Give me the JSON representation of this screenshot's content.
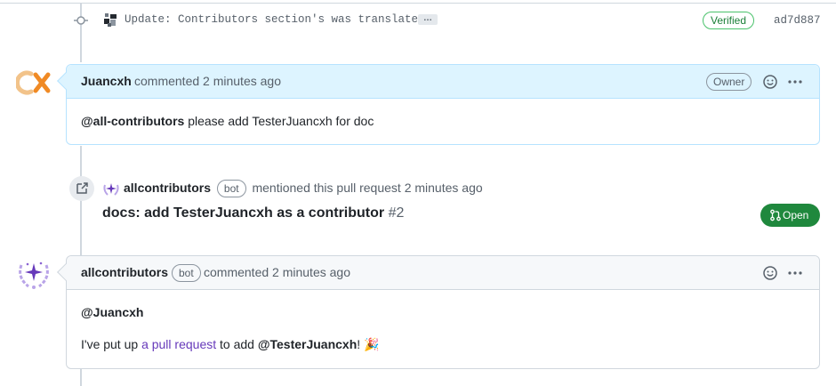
{
  "commit": {
    "message": "Update: Contributors section's was translate",
    "ellipsis": "…",
    "verified_label": "Verified",
    "sha": "ad7d887"
  },
  "owner_comment": {
    "author": "Juancxh",
    "meta": "commented 2 minutes ago",
    "role_badge": "Owner",
    "body_mention": "@all-contributors",
    "body_text": " please add TesterJuancxh for doc"
  },
  "mention_event": {
    "actor": "allcontributors",
    "bot_badge": "bot",
    "text": "mentioned this pull request 2 minutes ago",
    "pr_title": "docs: add TesterJuancxh as a contributor",
    "pr_number": "#2",
    "pr_state": "Open"
  },
  "bot_comment": {
    "author": "allcontributors",
    "bot_badge": "bot",
    "meta": "commented 2 minutes ago",
    "greeting": "@Juancxh",
    "line_prefix": "I've put up ",
    "link_text": "a pull request",
    "line_middle": " to add ",
    "line_mention": "@TesterJuancxh",
    "line_suffix": "! 🎉"
  },
  "colors": {
    "accent_link": "#6639ba",
    "verified_green": "#1a7f37",
    "open_green": "#1f883d",
    "owner_header_bg": "#ddf4ff",
    "juancxh_orange": "#f08a24"
  },
  "icons": [
    "git-commit-icon",
    "smiley-icon",
    "kebab-horizontal-icon",
    "cross-reference-icon",
    "git-pull-request-icon"
  ]
}
